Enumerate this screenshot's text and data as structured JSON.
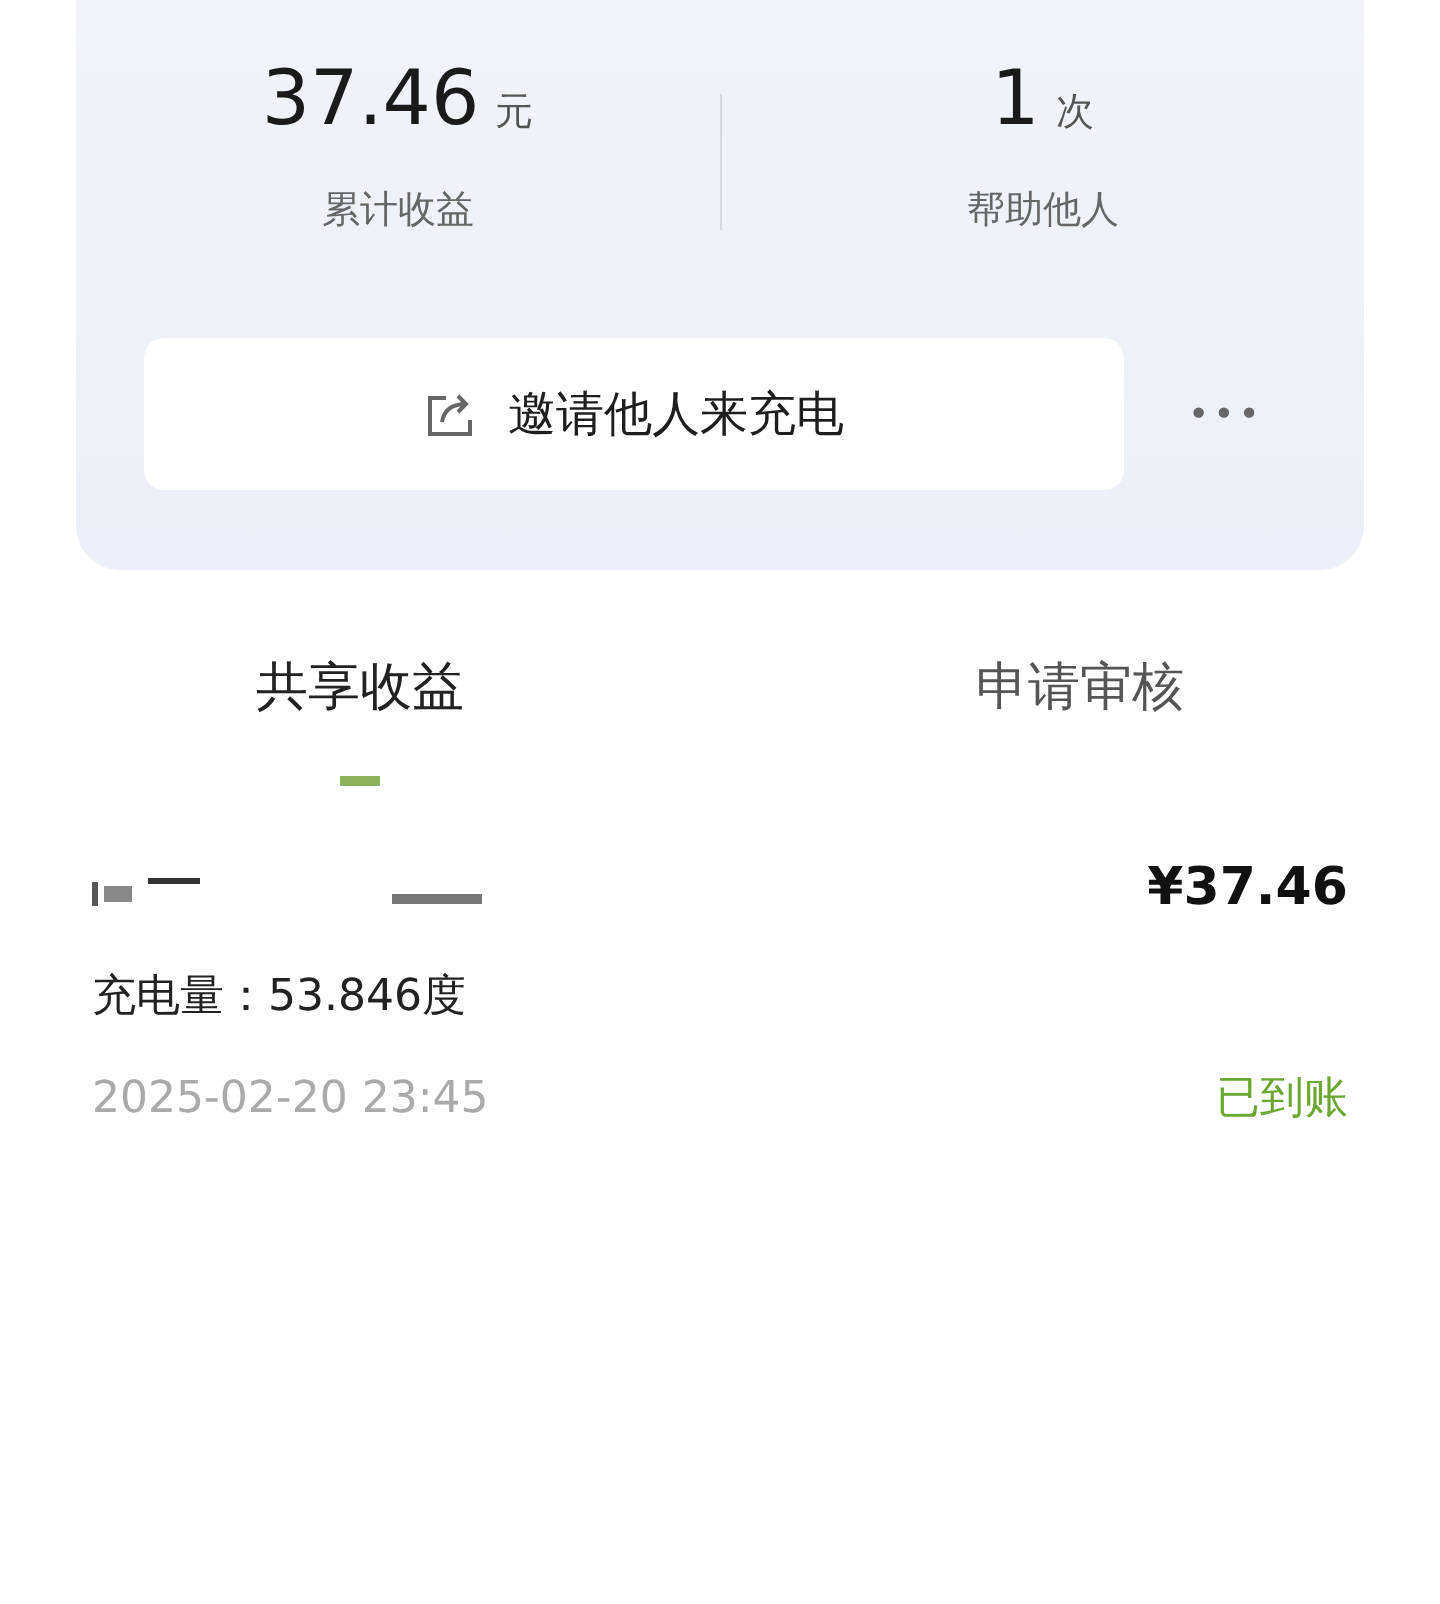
{
  "stats": [
    {
      "value": "37.46",
      "unit": "元",
      "label": "累计收益"
    },
    {
      "value": "1",
      "unit": "次",
      "label": "帮助他人"
    }
  ],
  "invite_button": {
    "label": "邀请他人来充电"
  },
  "more_button": {
    "label": "•••"
  },
  "tabs": [
    {
      "label": "共享收益",
      "selected": true
    },
    {
      "label": "申请审核",
      "selected": false
    }
  ],
  "records": [
    {
      "amount": "¥37.46",
      "energy": "充电量：53.846度",
      "time": "2025-02-20 23:45",
      "status": "已到账",
      "color": "#6aa832"
    }
  ]
}
